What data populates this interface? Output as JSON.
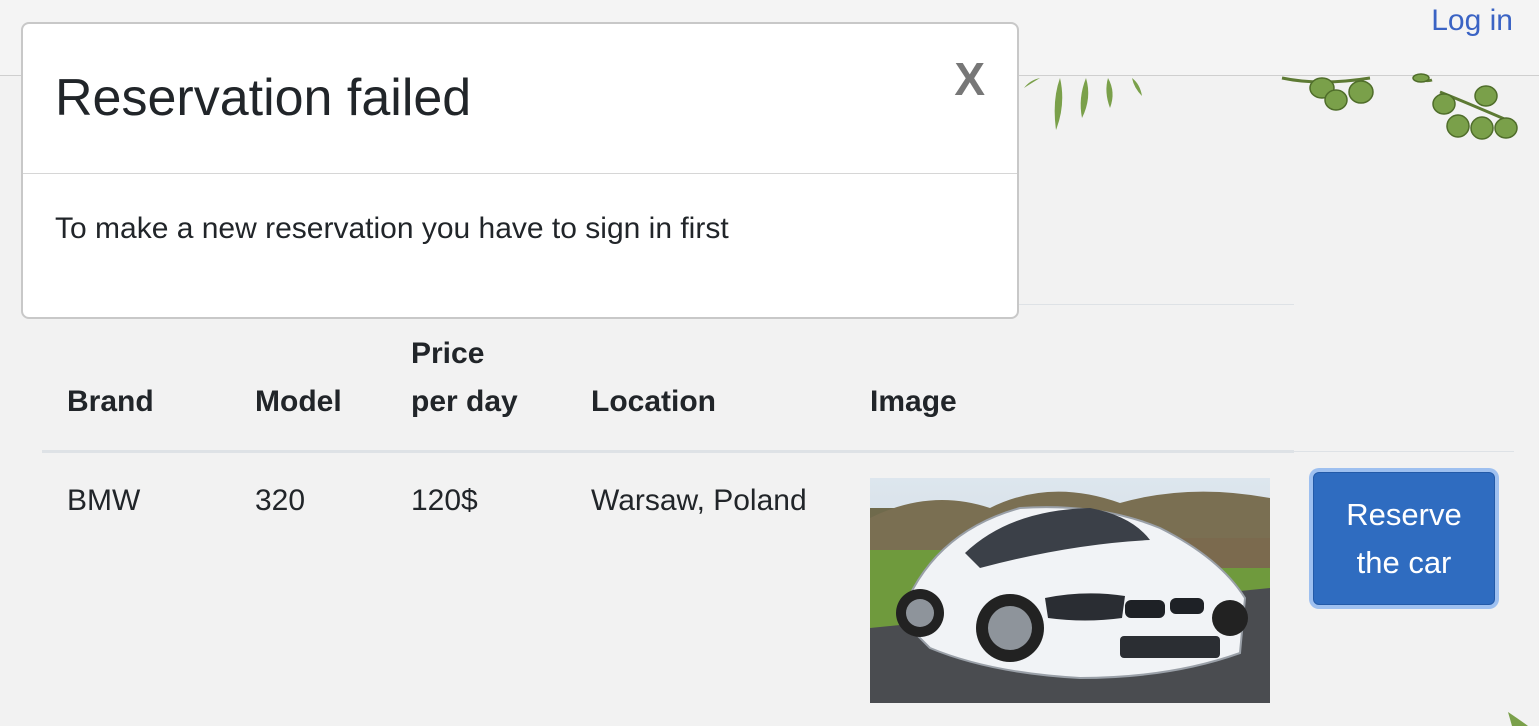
{
  "nav": {
    "login_label": "Log in"
  },
  "modal": {
    "title": "Reservation failed",
    "close_label": "X",
    "message": "To make a new reservation you have to sign in first"
  },
  "table": {
    "headers": {
      "brand": "Brand",
      "model": "Model",
      "price_line1": "Price",
      "price_line2": "per day",
      "location": "Location",
      "image": "Image"
    },
    "rows": [
      {
        "brand": "BMW",
        "model": "320",
        "price": "120$",
        "location": "Warsaw, Poland",
        "image": "white-bmw-car-photo",
        "action_line1": "Reserve",
        "action_line2": "the car"
      }
    ]
  },
  "colors": {
    "accent": "#2f6cc0",
    "link": "#3a63c4",
    "background": "#f2f2f2"
  }
}
